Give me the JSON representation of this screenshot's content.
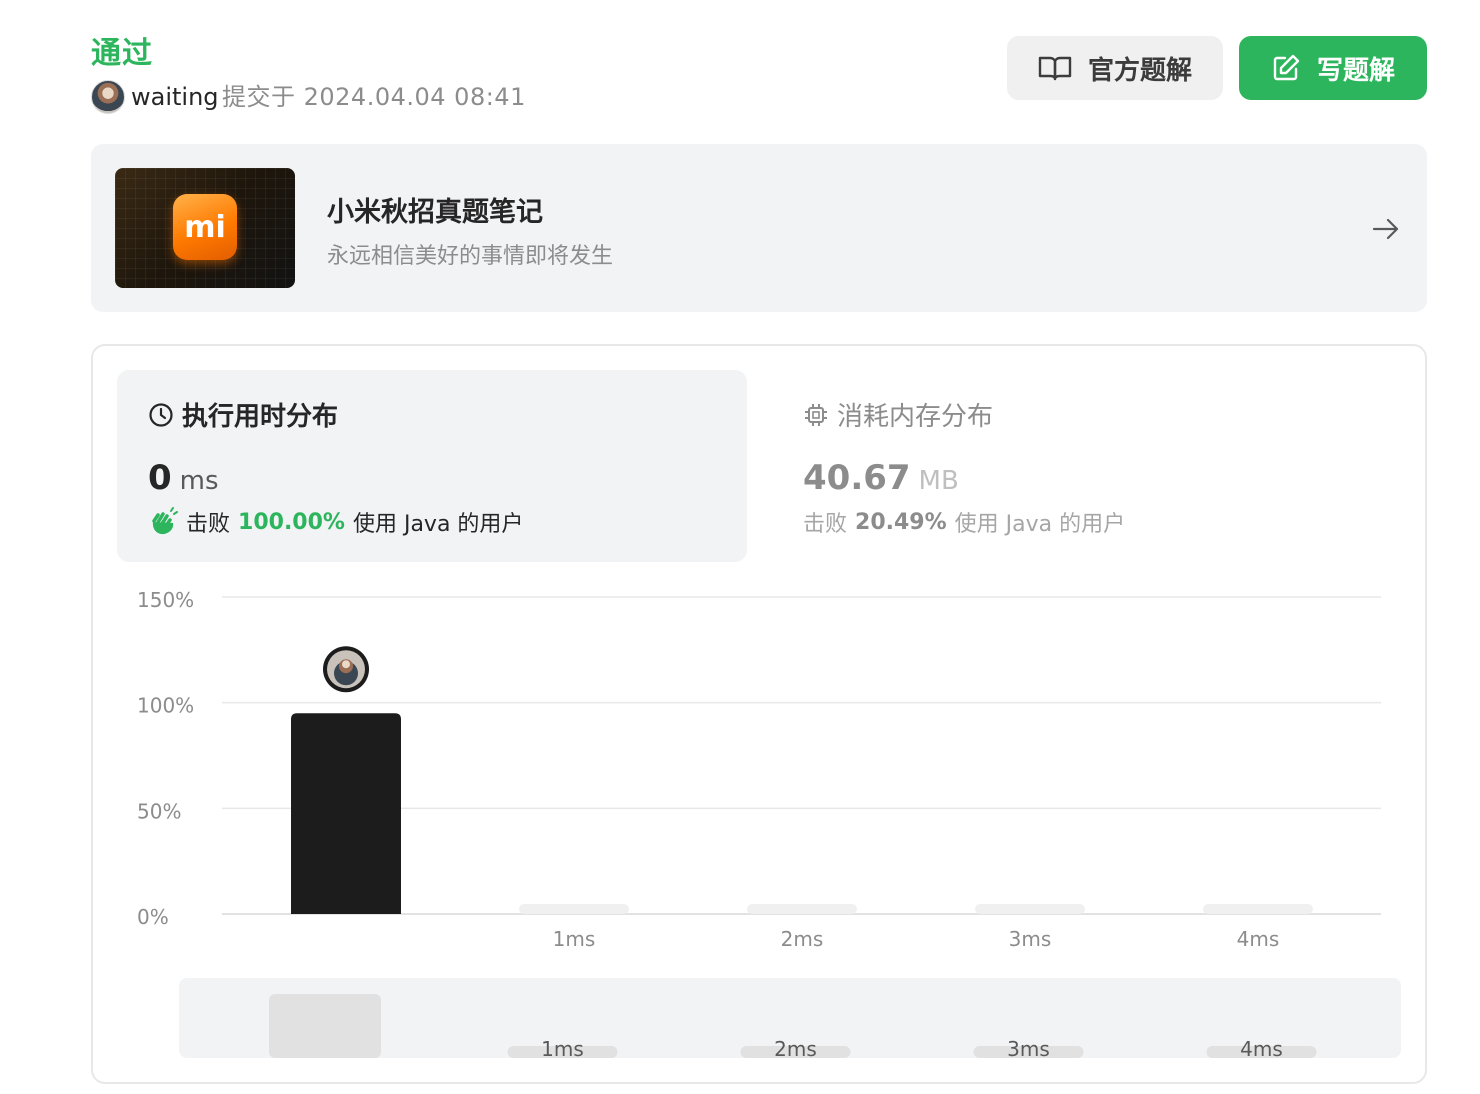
{
  "submission": {
    "status": "通过",
    "username": "waiting",
    "submitted_text": "提交于 2024.04.04 08:41"
  },
  "buttons": {
    "official_solution": "官方题解",
    "write_solution": "写题解"
  },
  "banner": {
    "title": "小米秋招真题笔记",
    "subtitle": "永远相信美好的事情即将发生",
    "logo_text": "mi"
  },
  "runtime": {
    "title": "执行用时分布",
    "value": "0",
    "unit": "ms",
    "beats_prefix": "击败",
    "beats_percent": "100.00%",
    "beats_suffix": "使用 Java 的用户"
  },
  "memory": {
    "title": "消耗内存分布",
    "value": "40.67",
    "unit": "MB",
    "beats_prefix": "击败",
    "beats_percent": "20.49%",
    "beats_suffix": "使用 Java 的用户"
  },
  "colors": {
    "accent_green": "#2db55d",
    "bar_dark": "#1c1c1c",
    "bar_light": "#f0f0f0"
  },
  "chart_data": {
    "type": "bar",
    "y_ticks": [
      "150%",
      "100%",
      "50%",
      "0%"
    ],
    "categories": [
      "",
      "1ms",
      "2ms",
      "3ms",
      "4ms"
    ],
    "values": [
      95,
      0,
      0,
      0,
      0
    ],
    "highlight_index": 0,
    "ylim": [
      0,
      150
    ],
    "grid": true,
    "mini_labels": [
      "",
      "1ms",
      "2ms",
      "3ms",
      "4ms"
    ]
  }
}
